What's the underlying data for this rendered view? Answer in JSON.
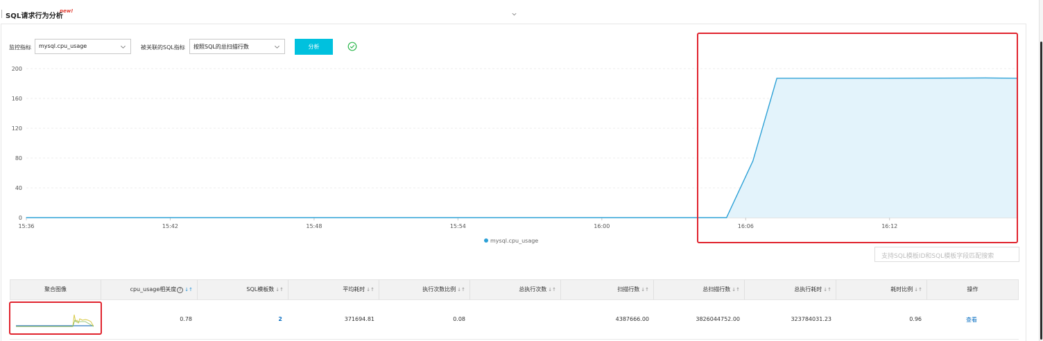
{
  "header": {
    "title": "SQL请求行为分析",
    "badge": "new!"
  },
  "toolbar": {
    "metric_label": "监控指标",
    "metric_value": "mysql.cpu_usage",
    "sql_metric_label": "被关联的SQL指标",
    "sql_metric_value": "按照SQL的总扫描行数",
    "analyze_label": "分析",
    "status_icon": "check-circle-icon"
  },
  "chart_data": {
    "type": "area",
    "y_ticks": [
      "200",
      "160",
      "120",
      "80",
      "40",
      "0"
    ],
    "ylim": [
      0,
      200
    ],
    "x_ticks": [
      "15:36",
      "15:42",
      "15:48",
      "15:54",
      "16:00",
      "16:06",
      "16:12"
    ],
    "x_tick_minutes": [
      0,
      6,
      12,
      18,
      24,
      30,
      36
    ],
    "xlim_minutes": [
      0,
      41.3
    ],
    "series": [
      {
        "name": "mysql.cpu_usage",
        "color": "#2ba0d6",
        "fill": "#e3f3fb",
        "x_minutes": [
          0,
          29.2,
          30.3,
          31.3,
          36,
          40,
          41.3
        ],
        "values": [
          0,
          0,
          76,
          187,
          187,
          187.5,
          187
        ]
      }
    ],
    "grid": "horizontal dashed",
    "legend_position": "bottom-center"
  },
  "search": {
    "placeholder": "支持SQL模板ID和SQL模板字段匹配搜索"
  },
  "table": {
    "columns": [
      {
        "label": "聚合图像",
        "sort": ""
      },
      {
        "label": "cpu_usage相关度",
        "sort": "↓↑",
        "help": "?"
      },
      {
        "label": "SQL模板数",
        "sort": "↓↑"
      },
      {
        "label": "平均耗时",
        "sort": "↓↑"
      },
      {
        "label": "执行次数比例",
        "sort": "↓↑"
      },
      {
        "label": "总执行次数",
        "sort": "↓↑"
      },
      {
        "label": "扫描行数",
        "sort": "↓↑"
      },
      {
        "label": "总扫描行数",
        "sort": "↓↑"
      },
      {
        "label": "总执行耗时",
        "sort": "↓↑"
      },
      {
        "label": "耗时比例",
        "sort": "↓↑"
      },
      {
        "label": "操作",
        "sort": ""
      }
    ],
    "rows": [
      {
        "correlation": "0.78",
        "templates": "2",
        "avg_time": "371694.81",
        "exec_ratio": "0.08",
        "total_exec": "",
        "scan_rows": "4387666.00",
        "total_scan_rows": "3826044752.00",
        "total_exec_time": "323784031.23",
        "time_ratio": "0.96",
        "action": "查看"
      }
    ]
  }
}
